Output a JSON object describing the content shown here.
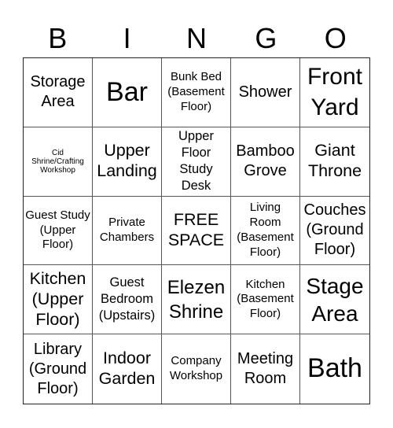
{
  "header": {
    "letters": [
      "B",
      "I",
      "N",
      "G",
      "O"
    ]
  },
  "cells": [
    "Storage Area",
    "Bar",
    "Bunk Bed (Basement Floor)",
    "Shower",
    "Front Yard",
    "Cid Shrine/Crafting Workshop",
    "Upper Landing",
    "Upper Floor Study Desk",
    "Bamboo Grove",
    "Giant Throne",
    "Guest Study (Upper Floor)",
    "Private Chambers",
    "FREE SPACE",
    "Living Room (Basement Floor)",
    "Couches (Ground Floor)",
    "Kitchen (Upper Floor)",
    "Guest Bedroom (Upstairs)",
    "Elezen Shrine",
    "Kitchen (Basement Floor)",
    "Stage Area",
    "Library (Ground Floor)",
    "Indoor Garden",
    "Company Workshop",
    "Meeting Room",
    "Bath"
  ]
}
